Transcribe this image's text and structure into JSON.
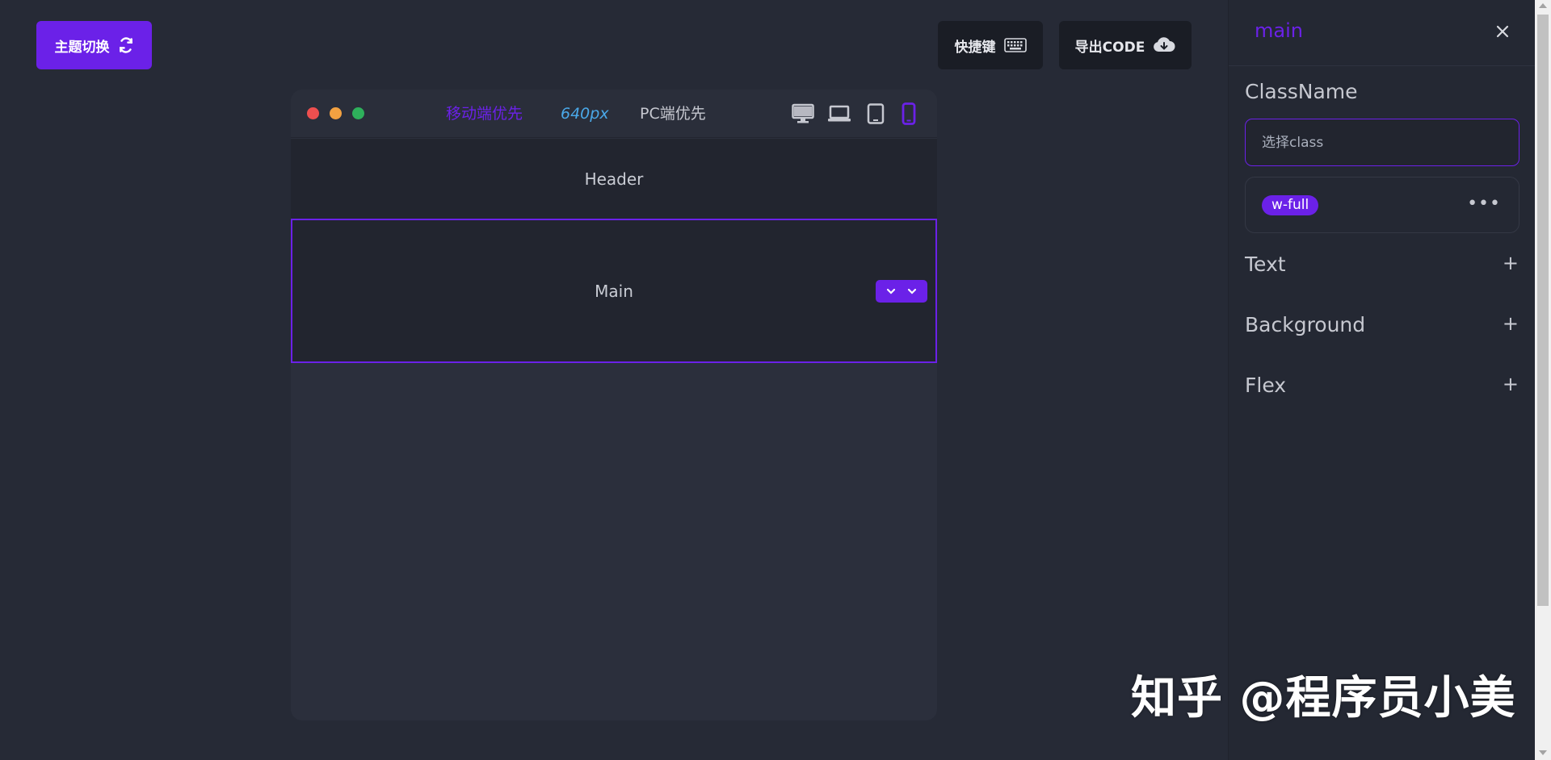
{
  "toolbar": {
    "theme_label": "主题切换",
    "shortcuts_label": "快捷键",
    "export_label": "导出CODE"
  },
  "frame": {
    "mobile_first": "移动端优先",
    "width_value": "640px",
    "pc_first": "PC端优先",
    "device_icons": [
      "desktop-icon",
      "laptop-icon",
      "tablet-icon",
      "mobile-icon"
    ],
    "selected_device": "mobile"
  },
  "canvas": {
    "header_label": "Header",
    "main_label": "Main"
  },
  "panel": {
    "title": "main",
    "classname_heading": "ClassName",
    "class_placeholder": "选择class",
    "tags": [
      "w-full"
    ],
    "sections": [
      "Text",
      "Background",
      "Flex"
    ]
  },
  "watermark": "知乎 @程序员小美",
  "colors": {
    "accent": "#6b21e8",
    "background": "#262a36",
    "panel": "#242833",
    "width_value": "#4aa8e8"
  }
}
